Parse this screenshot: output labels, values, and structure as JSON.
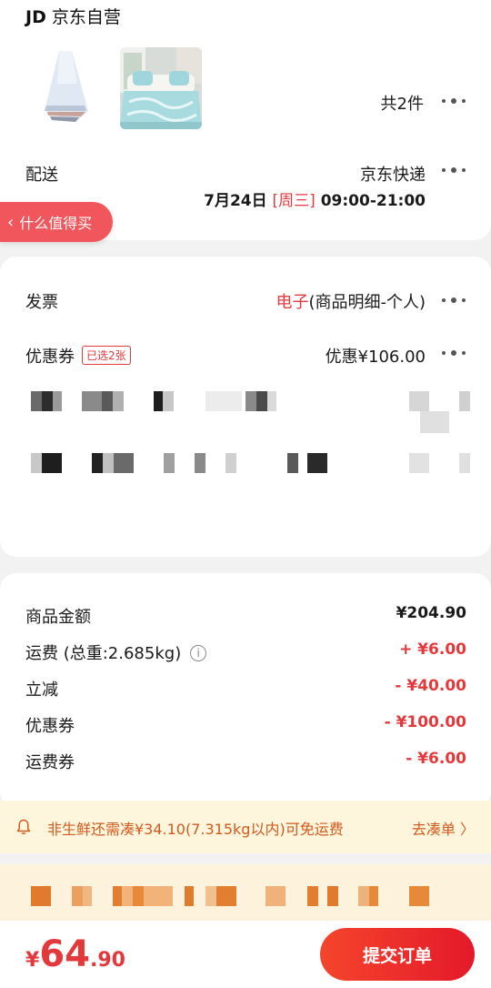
{
  "store": {
    "logo": "JD",
    "name": "京东自营"
  },
  "items": {
    "count_label": "共2件"
  },
  "delivery": {
    "label": "配送",
    "carrier": "京东快递",
    "date": "7月24日",
    "weekday": "[周三]",
    "time": "09:00-21:00"
  },
  "recommend_pill": {
    "label": "什么值得买"
  },
  "invoice": {
    "label": "发票",
    "type": "电子",
    "detail": "(商品明细-个人)"
  },
  "coupon": {
    "label": "优惠券",
    "tag": "已选2张",
    "value": "优惠¥106.00"
  },
  "summary": {
    "rows": [
      {
        "label": "商品金额",
        "value": "¥204.90"
      },
      {
        "label": "运费 (总重:2.685kg)",
        "value": "+ ¥6.00"
      },
      {
        "label": "立减",
        "value": "- ¥40.00"
      },
      {
        "label": "优惠券",
        "value": "- ¥100.00"
      },
      {
        "label": "运费券",
        "value": "- ¥6.00"
      }
    ]
  },
  "notice": {
    "text": "非生鲜还需凑¥34.10(7.315kg以内)可免运费",
    "link": "去凑单 〉"
  },
  "footer": {
    "currency": "¥",
    "amount_int": "64",
    "amount_dec": ".90",
    "submit_label": "提交订单"
  },
  "colors": {
    "accent": "#e4393c",
    "notice_bg": "#fdf6dc",
    "notice_text": "#d25a1e"
  }
}
